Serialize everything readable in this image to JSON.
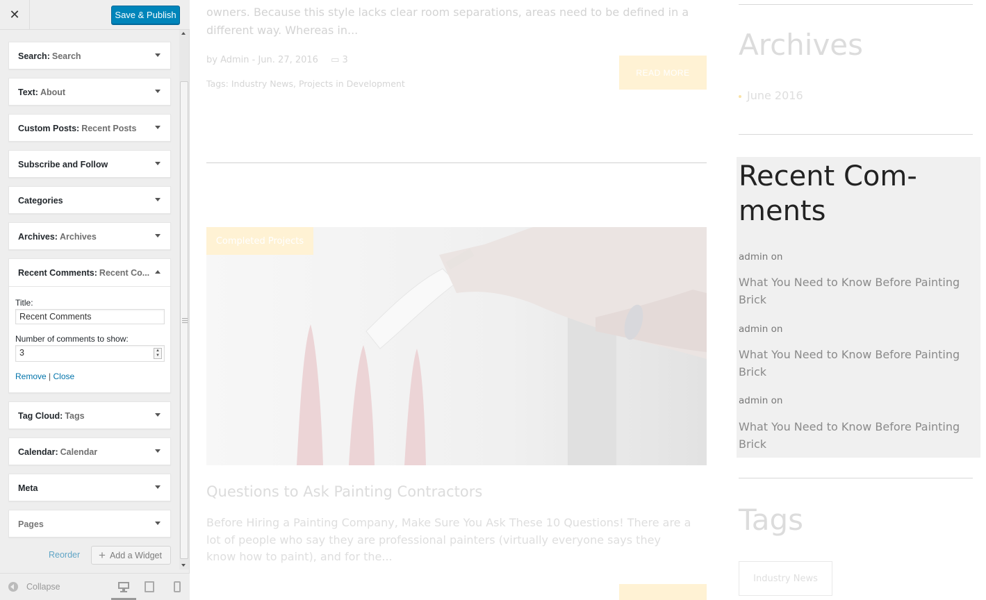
{
  "header": {
    "close_label": "✕",
    "save_label": "Save & Publish"
  },
  "widgets": [
    {
      "type": "Search:",
      "title": "Search"
    },
    {
      "type": "Text:",
      "title": "About"
    },
    {
      "type": "Custom Posts:",
      "title": "Recent Posts"
    },
    {
      "type": "Subscribe and Follow",
      "title": ""
    },
    {
      "type": "Categories",
      "title": ""
    },
    {
      "type": "Archives:",
      "title": "Archives"
    },
    {
      "type": "Recent Comments:",
      "title": "Recent Co..."
    },
    {
      "type": "Tag Cloud:",
      "title": "Tags"
    },
    {
      "type": "Calendar:",
      "title": "Calendar"
    },
    {
      "type": "Meta",
      "title": ""
    },
    {
      "type": "Pages",
      "title": ""
    }
  ],
  "open_widget": {
    "title_label": "Title:",
    "title_value": "Recent Comments",
    "count_label": "Number of comments to show:",
    "count_value": "3",
    "remove_label": "Remove",
    "separator": "|",
    "close_label": "Close"
  },
  "footer_actions": {
    "reorder_label": "Reorder",
    "add_widget_label": "Add a Widget"
  },
  "footer": {
    "collapse_label": "Collapse"
  },
  "preview": {
    "excerpt_top": "owners. Because this style lacks clear room separations, areas need to be defined in a different way. Whereas in...",
    "meta": "by Admin - Jun. 27, 2016",
    "comment_count": "3",
    "tags": "Tags: Industry News, Projects in Development",
    "read_more": "READ MORE",
    "category_badge": "Completed Projects",
    "post_title": "Questions to Ask Painting Contractors",
    "post_excerpt": "Before Hiring a Painting Company, Make Sure You Ask These 10 Questions! There are a lot of people who say they are professional painters (virtually everyone says they know how to paint), and for the..."
  },
  "sidebar_widgets": {
    "archives_title": "Archives",
    "archive_item": "June 2016",
    "recent_comments_title": "Recent Com-ments",
    "comments": [
      {
        "author": "admin on",
        "link": "What You Need to Know Before Painting Brick"
      },
      {
        "author": "admin on",
        "link": "What You Need to Know Before Painting Brick"
      },
      {
        "author": "admin on",
        "link": "What You Need to Know Before Painting Brick"
      }
    ],
    "tags_title": "Tags",
    "tag_pill": "Industry News"
  },
  "colors": {
    "primary_button": "#0085ba",
    "link": "#0073aa",
    "accent_badge": "#fff2d4"
  }
}
